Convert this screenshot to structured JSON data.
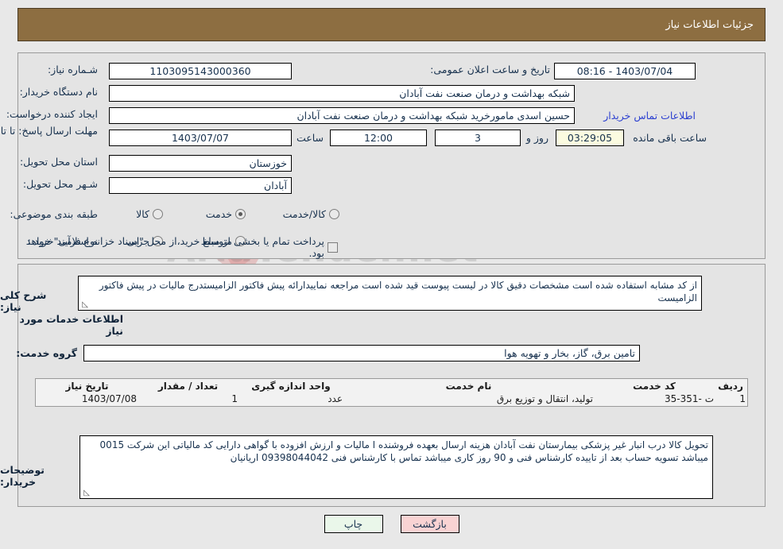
{
  "header": {
    "title": "جزئیات اطلاعات نیاز"
  },
  "form": {
    "need_number": {
      "label": "شـماره نیاز:",
      "value": "1103095143000360"
    },
    "announce_datetime": {
      "label": "تاریخ و ساعت اعلان عمومی:",
      "value": "1403/07/04 - 08:16"
    },
    "buyer_org": {
      "label": "نام دستگاه خریدار:",
      "value": "شبکه بهداشت و درمان صنعت نفت آبادان"
    },
    "requester": {
      "label": "ایجاد کننده درخواست:",
      "value": "حسین اسدی مامورخرید شبکه بهداشت و درمان صنعت نفت آبادان"
    },
    "buyer_contact_link": "اطلاعات تماس خریدار",
    "deadline": {
      "label": "مهلت ارسال پاسخ: تا تاریخ:",
      "date": "1403/07/07",
      "time_label": "ساعت",
      "time": "12:00",
      "days": "3",
      "days_suffix": "روز و",
      "countdown": "03:29:05",
      "countdown_suffix": "ساعت باقی مانده"
    },
    "province": {
      "label": "استان محل تحویل:",
      "value": "خوزستان"
    },
    "city": {
      "label": "شـهر محل تحویل:",
      "value": "آبادان"
    },
    "category": {
      "label": "طبقه بندی موضوعی:",
      "options": [
        "کالا",
        "خدمت",
        "کالا/خدمت"
      ],
      "selected": "خدمت"
    },
    "process_type": {
      "label": "نوع فرآیند خرید :",
      "options": [
        "جزیی",
        "متوسط"
      ],
      "selected": "",
      "treasury_checkbox_label": "پرداخت تمام یا بخشی از مبلغ خرید،از محل \"اسناد خزانه اسلامی\" خواهد بود.",
      "treasury_checked": false
    }
  },
  "details": {
    "general_description": {
      "label": "شرح کلی نیاز:",
      "value": "از کد مشابه استفاده شده است مشخصات دقیق کالا در لیست پیوست قید شده است مراجعه نماییدارائه پیش فاکتور الزامیستدرج مالیات در پیش فاکتور الزامیست"
    },
    "services_heading": "اطلاعات خدمات مورد نیاز",
    "service_group": {
      "label": "گروه خدمت:",
      "value": "تامین برق، گاز، بخار و تهویه هوا"
    },
    "table": {
      "columns": [
        "ردیف",
        "کد خدمت",
        "نام خدمت",
        "واحد اندازه گیری",
        "تعداد / مقدار",
        "تاریخ نیاز"
      ],
      "rows": [
        {
          "row": "1",
          "service_code": "ت -351-35",
          "service_name": "تولید، انتقال و توزیع برق",
          "unit": "عدد",
          "quantity": "1",
          "need_date": "1403/07/08"
        }
      ]
    },
    "buyer_notes": {
      "label": "توضیحات خریدار:",
      "value": "تحویل کالا درب انبار غیر پزشکی بیمارستان نفت آبادان هزینه ارسال بعهده فروشنده ا مالیات و ارزش افزوده با گواهی دارایی کد مالیاتی این شرکت 0015 میباشد  تسویه حساب بعد از تاییده کارشناس فنی و 90 روز کاری میباشد تماس با کارشناس فنی 09398044042 اریانیان"
    }
  },
  "footer": {
    "print_label": "چاپ",
    "back_label": "بازگشت"
  },
  "watermark": {
    "text": "AriaTender.net"
  }
}
